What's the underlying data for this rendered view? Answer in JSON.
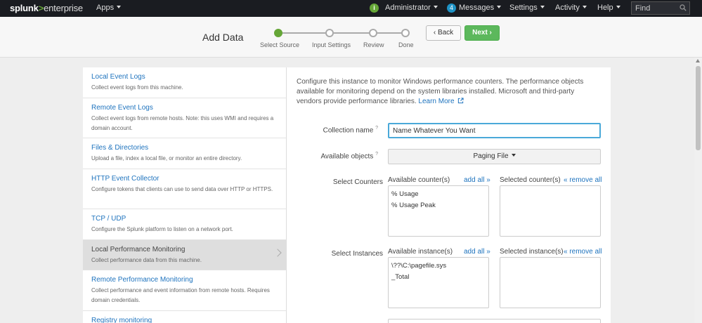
{
  "topbar": {
    "logo_brand": "splunk",
    "logo_sep": ">",
    "logo_product": "enterprise",
    "apps_label": "Apps",
    "admin_label": "Administrator",
    "info_icon": "i",
    "messages_count": "4",
    "messages_label": "Messages",
    "settings_label": "Settings",
    "activity_label": "Activity",
    "help_label": "Help",
    "find_placeholder": "Find"
  },
  "wizard": {
    "title": "Add Data",
    "steps": [
      "Select Source",
      "Input Settings",
      "Review",
      "Done"
    ],
    "active_step": 0,
    "back_label": "Back",
    "next_label": "Next",
    "colors": {
      "active": "#65a637",
      "next_button": "#5cb85c"
    }
  },
  "sources": [
    {
      "title": "Local Event Logs",
      "desc": "Collect event logs from this machine."
    },
    {
      "title": "Remote Event Logs",
      "desc": "Collect event logs from remote hosts. Note: this uses WMI and requires a domain account."
    },
    {
      "title": "Files & Directories",
      "desc": "Upload a file, index a local file, or monitor an entire directory."
    },
    {
      "title": "HTTP Event Collector",
      "desc": "Configure tokens that clients can use to send data over HTTP or HTTPS."
    },
    {
      "title": "TCP / UDP",
      "desc": "Configure the Splunk platform to listen on a network port."
    },
    {
      "title": "Local Performance Monitoring",
      "desc": "Collect performance data from this machine.",
      "selected": true
    },
    {
      "title": "Remote Performance Monitoring",
      "desc": "Collect performance and event information from remote hosts. Requires domain credentials."
    },
    {
      "title": "Registry monitoring",
      "desc": ""
    }
  ],
  "form": {
    "description": "Configure this instance to monitor Windows performance counters. The performance objects available for monitoring depend on the system libraries installed. Microsoft and third-party vendors provide performance libraries.",
    "learn_more": "Learn More",
    "collection_name_label": "Collection name",
    "collection_name_value": "Name Whatever You Want",
    "available_objects_label": "Available objects",
    "available_objects_value": "Paging File",
    "help_mark": "?",
    "select_counters_label": "Select Counters",
    "available_counters_label": "Available counter(s)",
    "add_all_label": "add all »",
    "selected_counters_label": "Selected counter(s)",
    "remove_all_label": "« remove all",
    "available_counters": [
      "% Usage",
      "% Usage Peak"
    ],
    "select_instances_label": "Select Instances",
    "available_instances_label": "Available instance(s)",
    "selected_instances_label": "Selected instance(s)",
    "available_instances": [
      "\\??\\C:\\pagefile.sys",
      "_Total"
    ]
  }
}
